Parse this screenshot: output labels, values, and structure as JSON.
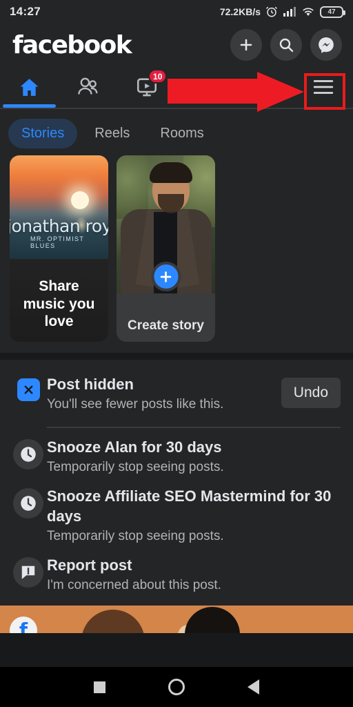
{
  "statusbar": {
    "time": "14:27",
    "network_speed": "72.2KB/s",
    "alarm_icon": "alarm-clock-icon",
    "signal_icon": "cellular-signal-icon",
    "wifi_icon": "wifi-icon",
    "battery_level": "47"
  },
  "header": {
    "logo": "facebook",
    "actions": [
      {
        "name": "create-button",
        "icon": "plus-icon"
      },
      {
        "name": "search-button",
        "icon": "search-icon"
      },
      {
        "name": "messenger-button",
        "icon": "messenger-icon"
      }
    ]
  },
  "navtabs": [
    {
      "name": "tab-home",
      "icon": "home-icon",
      "active": true,
      "badge": ""
    },
    {
      "name": "tab-friends",
      "icon": "friends-icon",
      "active": false,
      "badge": ""
    },
    {
      "name": "tab-watch",
      "icon": "watch-icon",
      "active": false,
      "badge": "10"
    },
    {
      "name": "tab-marketplace",
      "icon": "marketplace-icon",
      "active": false,
      "badge": ""
    },
    {
      "name": "tab-notifications",
      "icon": "notifications-icon",
      "active": false,
      "badge": ""
    },
    {
      "name": "tab-menu",
      "icon": "hamburger-menu-icon",
      "active": false,
      "badge": ""
    }
  ],
  "annotation": {
    "arrow_color": "#ed1c24",
    "highlight_color": "#e81c1c",
    "points_at": "hamburger-menu-icon"
  },
  "stories": {
    "chips": [
      {
        "label": "Stories",
        "active": true
      },
      {
        "label": "Reels",
        "active": false
      },
      {
        "label": "Rooms",
        "active": false
      }
    ],
    "cards": [
      {
        "type": "music",
        "art_title": "jonathan roy",
        "art_subtitle": "MR. OPTIMIST BLUES",
        "caption": "Share music you love"
      },
      {
        "type": "create",
        "caption": "Create story",
        "plus_icon": "plus-icon"
      }
    ]
  },
  "menu": {
    "post_hidden": {
      "icon": "close-x-icon",
      "title": "Post hidden",
      "subtitle": "You'll see fewer posts like this.",
      "undo_label": "Undo"
    },
    "options": [
      {
        "icon": "clock-icon",
        "title": "Snooze Alan for 30 days",
        "subtitle": "Temporarily stop seeing posts."
      },
      {
        "icon": "clock-icon",
        "title": "Snooze Affiliate SEO Mastermind for 30 days",
        "subtitle": "Temporarily stop seeing posts."
      },
      {
        "icon": "report-flag-icon",
        "title": "Report post",
        "subtitle": "I'm concerned about this post."
      }
    ]
  },
  "post_peek": {
    "badge": "f",
    "background_color": "#d4854a"
  },
  "android_nav": [
    {
      "name": "recents-button",
      "icon": "square-icon"
    },
    {
      "name": "home-button",
      "icon": "circle-icon"
    },
    {
      "name": "back-button",
      "icon": "triangle-back-icon"
    }
  ],
  "colors": {
    "app_background": "#18191a",
    "surface": "#242526",
    "accent_blue": "#2d88ff",
    "badge_red": "#e41e3f"
  }
}
